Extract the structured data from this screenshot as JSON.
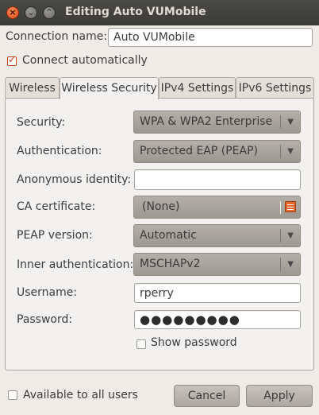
{
  "window": {
    "title": "Editing Auto VUMobile",
    "close_symbol": "×",
    "min_symbol": "⌄",
    "max_symbol": "⌃"
  },
  "connection_name": {
    "label": "Connection name:",
    "value": "Auto VUMobile"
  },
  "connect_automatically": {
    "label": "Connect automatically",
    "checked": true
  },
  "tabs": [
    {
      "label": "Wireless"
    },
    {
      "label": "Wireless Security"
    },
    {
      "label": "IPv4 Settings"
    },
    {
      "label": "IPv6 Settings"
    }
  ],
  "security": {
    "label": "Security:",
    "value": "WPA & WPA2 Enterprise"
  },
  "authentication": {
    "label": "Authentication:",
    "value": "Protected EAP (PEAP)"
  },
  "anonymous_identity": {
    "label": "Anonymous identity:",
    "value": ""
  },
  "ca_certificate": {
    "label": "CA certificate:",
    "value": "(None)"
  },
  "peap_version": {
    "label": "PEAP version:",
    "value": "Automatic"
  },
  "inner_authentication": {
    "label": "Inner authentication:",
    "value": "MSCHAPv2"
  },
  "username": {
    "label": "Username:",
    "value": "rperry"
  },
  "password": {
    "label": "Password:",
    "masked": "●●●●●●●●●"
  },
  "show_password": {
    "label": "Show password",
    "checked": false
  },
  "available_to_all": {
    "label": "Available to all users",
    "checked": false
  },
  "buttons": {
    "cancel": "Cancel",
    "apply": "Apply"
  },
  "colors": {
    "titlebar": "#3c3b37",
    "close_button": "#df4a16",
    "background": "#efebe7",
    "combo": "#a8a49d"
  }
}
